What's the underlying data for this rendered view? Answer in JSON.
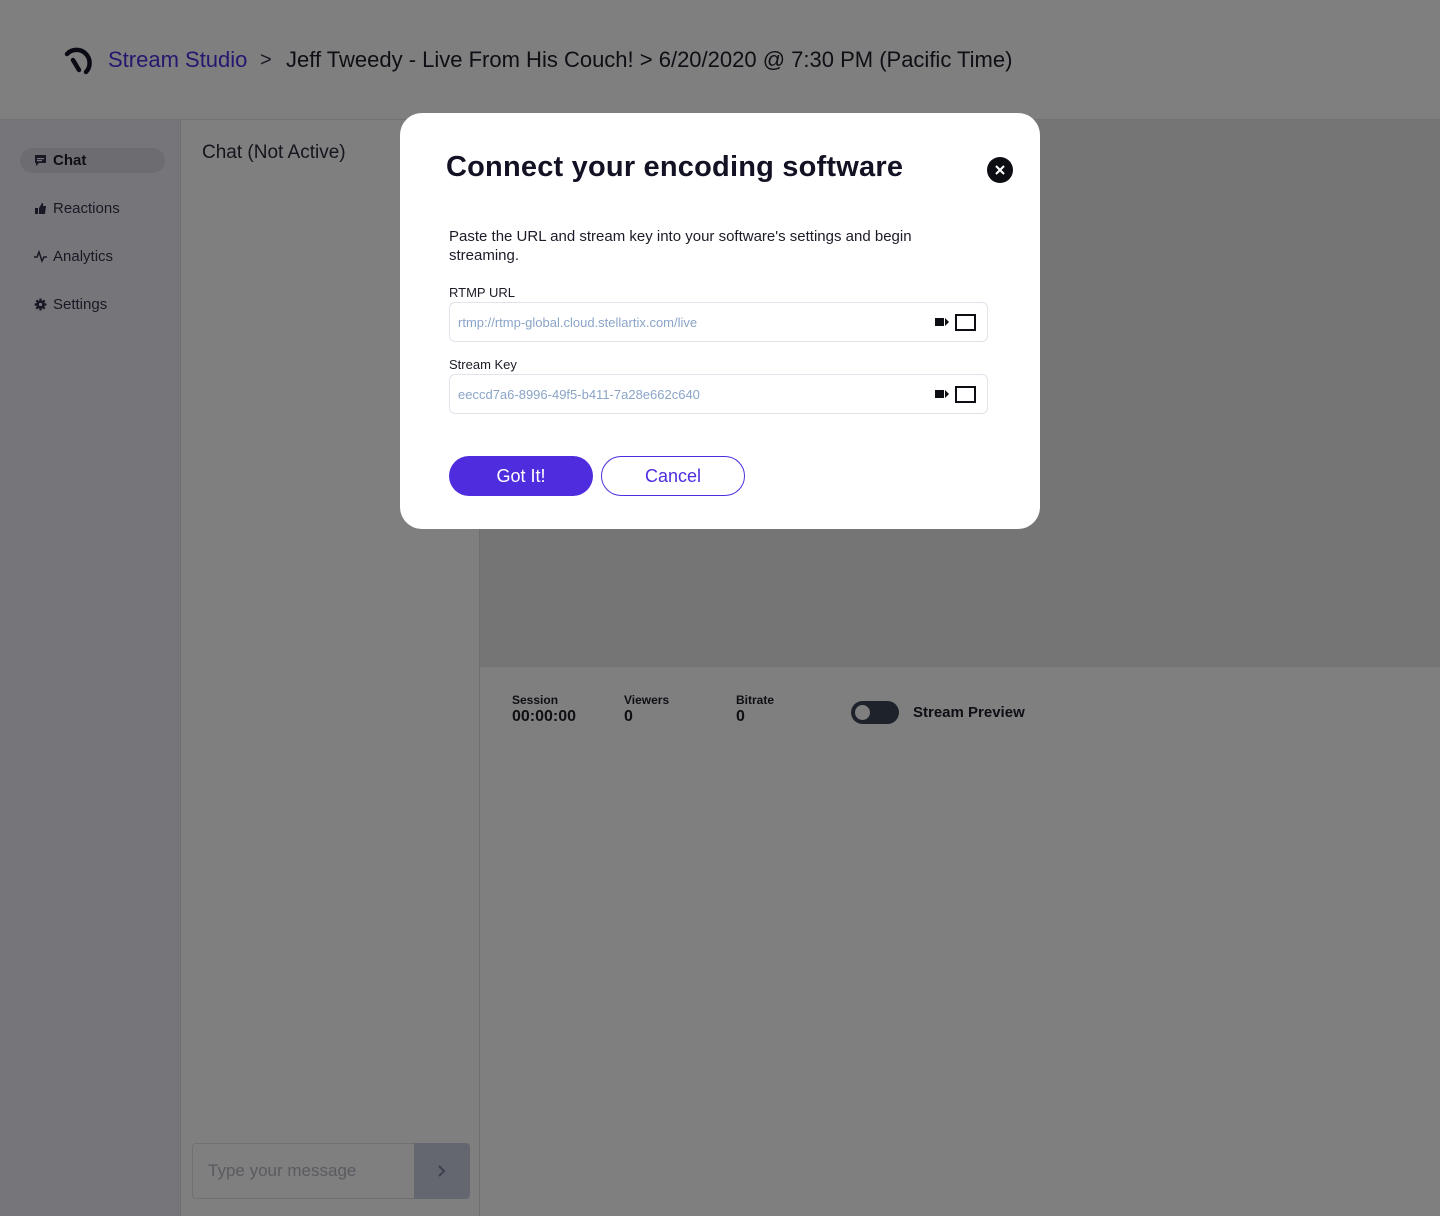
{
  "header": {
    "brand": "Stream Studio",
    "separator": ">",
    "event": "Jeff Tweedy - Live From His Couch! > 6/20/2020 @ 7:30 PM (Pacific Time)"
  },
  "sidebar": {
    "items": [
      {
        "label": "Chat",
        "icon": "chat-icon",
        "active": true
      },
      {
        "label": "Reactions",
        "icon": "thumbs-up-icon",
        "active": false
      },
      {
        "label": "Analytics",
        "icon": "pulse-icon",
        "active": false
      },
      {
        "label": "Settings",
        "icon": "gear-icon",
        "active": false
      }
    ]
  },
  "chat": {
    "title": "Chat (Not Active)",
    "input_placeholder": "Type your message"
  },
  "stats": {
    "session_label": "Session",
    "session_value": "00:00:00",
    "viewers_label": "Viewers",
    "viewers_value": "0",
    "bitrate_label": "Bitrate",
    "bitrate_value": "0",
    "preview_label": "Stream Preview",
    "preview_on": false
  },
  "modal": {
    "title": "Connect your encoding software",
    "description": "Paste the URL and stream key into your software's settings and begin streaming.",
    "rtmp_label": "RTMP URL",
    "rtmp_value": "rtmp://rtmp-global.cloud.stellartix.com/live",
    "key_label": "Stream Key",
    "key_value": "eeccd7a6-8996-49f5-b411-7a28e662c640",
    "confirm_label": "Got It!",
    "cancel_label": "Cancel"
  },
  "colors": {
    "accent": "#4f2cde",
    "overlay": "rgba(0,0,0,0.5)"
  }
}
